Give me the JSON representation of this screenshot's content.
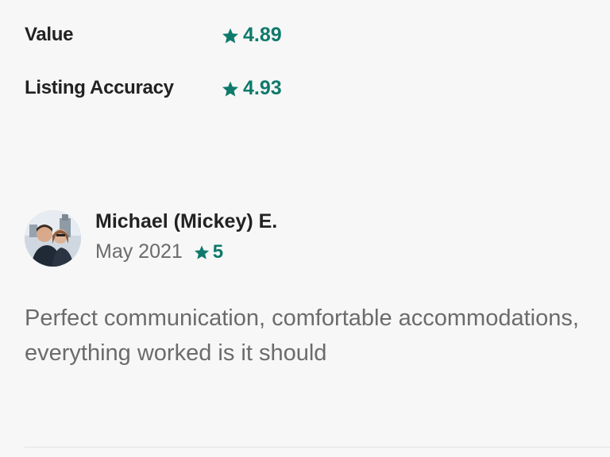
{
  "ratings": [
    {
      "label": "Value",
      "score": "4.89",
      "icon": "star-icon"
    },
    {
      "label": "Listing Accuracy",
      "score": "4.93",
      "icon": "star-icon"
    }
  ],
  "review": {
    "reviewer_name": "Michael (Mickey) E.",
    "date": "May 2021",
    "rating": "5",
    "text": "Perfect communication, comfortable accommodations, everything worked is it should"
  },
  "colors": {
    "accent": "#0e7a6b",
    "text_primary": "#222222",
    "text_secondary": "#6b6b6b",
    "background": "#f7f7f7"
  }
}
